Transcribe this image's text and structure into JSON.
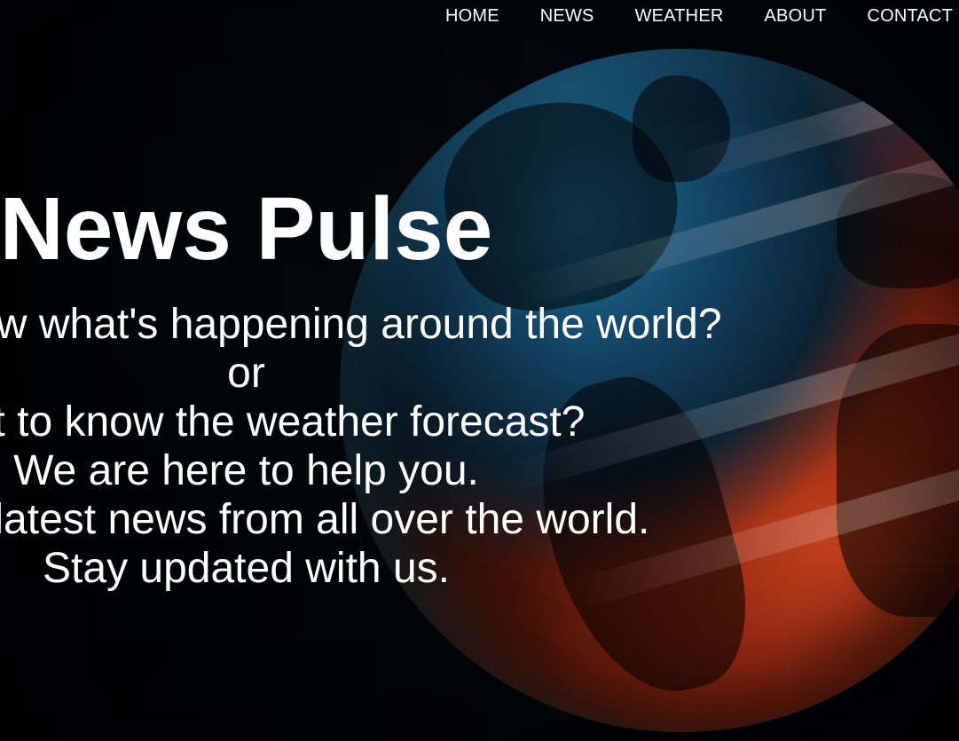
{
  "nav": {
    "items": [
      {
        "label": "HOME"
      },
      {
        "label": "NEWS"
      },
      {
        "label": "WEATHER"
      },
      {
        "label": "ABOUT"
      },
      {
        "label": "CONTACT"
      }
    ]
  },
  "hero": {
    "title": "News Pulse",
    "lines": [
      "Want to know what's happening around the world?",
      "or",
      "Want to know the weather forecast?",
      "We are here to help you.",
      "Get the latest news from all over the world.",
      "Stay updated with us."
    ]
  },
  "background": {
    "image": "globe-earth-graphic",
    "colors": {
      "ocean_blue": "#1d6f96",
      "glow_red": "#c2401c",
      "base": "#000000"
    }
  }
}
